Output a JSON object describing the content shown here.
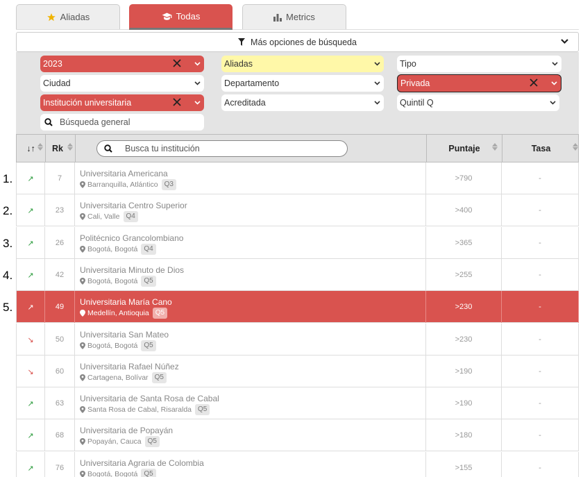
{
  "tabs": [
    {
      "label": "Aliadas",
      "icon": "star-icon"
    },
    {
      "label": "Todas",
      "icon": "graduation-cap-icon",
      "active": true
    },
    {
      "label": "Metrics",
      "icon": "bar-chart-icon"
    }
  ],
  "options": {
    "label": "Más opciones de búsqueda"
  },
  "filters": {
    "year": "2023",
    "aliadas": "Aliadas",
    "tipo": "Tipo",
    "ciudad": "Ciudad",
    "departamento": "Departamento",
    "privada": "Privada",
    "institucion": "Institución universitaria",
    "acreditada": "Acreditada",
    "quintil": "Quintil Q",
    "busqueda_placeholder": "Búsqueda general"
  },
  "table": {
    "headers": {
      "sort": "↓↑",
      "rk": "Rk",
      "search_placeholder": "Busca tu institución",
      "puntaje": "Puntaje",
      "tasa": "Tasa"
    },
    "rows": [
      {
        "pos": "1.",
        "trend": "up",
        "rk": "7",
        "name": "Universitaria Americana",
        "loc": "Barranquilla, Atlántico",
        "q": "Q3",
        "score": ">790",
        "tasa": "-"
      },
      {
        "pos": "2.",
        "trend": "up",
        "rk": "23",
        "name": "Universitaria Centro Superior",
        "loc": "Cali, Valle",
        "q": "Q4",
        "score": ">400",
        "tasa": "-"
      },
      {
        "pos": "3.",
        "trend": "up",
        "rk": "26",
        "name": "Politécnico Grancolombiano",
        "loc": "Bogotá, Bogotá",
        "q": "Q4",
        "score": ">365",
        "tasa": "-"
      },
      {
        "pos": "4.",
        "trend": "up",
        "rk": "42",
        "name": "Universitaria Minuto de Dios",
        "loc": "Bogotá, Bogotá",
        "q": "Q5",
        "score": ">255",
        "tasa": "-"
      },
      {
        "pos": "5.",
        "trend": "up",
        "rk": "49",
        "name": "Universitaria María Cano",
        "loc": "Medellín, Antioquia",
        "q": "Q5",
        "score": ">230",
        "tasa": "-",
        "highlight": true
      },
      {
        "pos": "",
        "trend": "down",
        "rk": "50",
        "name": "Universitaria San Mateo",
        "loc": "Bogotá, Bogotá",
        "q": "Q5",
        "score": ">230",
        "tasa": "-"
      },
      {
        "pos": "",
        "trend": "down",
        "rk": "60",
        "name": "Universitaria Rafael Núñez",
        "loc": "Cartagena, Bolívar",
        "q": "Q5",
        "score": ">190",
        "tasa": "-"
      },
      {
        "pos": "",
        "trend": "up",
        "rk": "63",
        "name": "Universitaria de Santa Rosa de Cabal",
        "loc": "Santa Rosa de Cabal, Risaralda",
        "q": "Q5",
        "score": ">190",
        "tasa": "-"
      },
      {
        "pos": "",
        "trend": "up",
        "rk": "68",
        "name": "Universitaria de Popayán",
        "loc": "Popayán, Cauca",
        "q": "Q5",
        "score": ">180",
        "tasa": "-"
      },
      {
        "pos": "",
        "trend": "up",
        "rk": "76",
        "name": "Universitaria Agraria de Colombia",
        "loc": "Bogotá, Bogotá",
        "q": "Q5",
        "score": ">155",
        "tasa": "-"
      }
    ]
  },
  "colors": {
    "accent": "#d9534f",
    "highlight_yellow": "#fff8a8",
    "trend_up": "#2e9c3e",
    "trend_down": "#d9534f"
  }
}
